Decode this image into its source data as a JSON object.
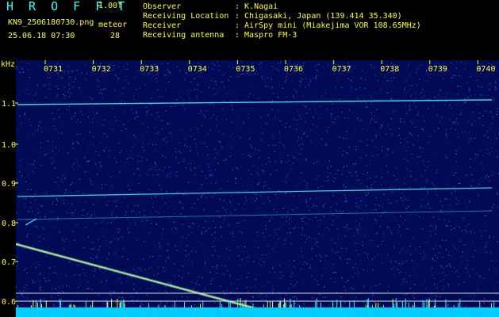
{
  "header": {
    "logo": "H R O F F T",
    "version": "1.00f",
    "filename": "KN9_2506180730.png",
    "meteor_label": "meteor",
    "datetime": "25.06.18 07:30",
    "meteor_count": "28",
    "info": [
      {
        "label": "Observer",
        "value": ": K.Nagai"
      },
      {
        "label": "Receiving Location",
        "value": ": Chigasaki, Japan (139.414 35.340)"
      },
      {
        "label": "Receiver",
        "value": ": AirSpy mini (Miakejima VOR 108.65MHz)"
      },
      {
        "label": "Receiving antenna",
        "value": ": Maspro FM-3"
      }
    ]
  },
  "spectrogram": {
    "y_unit": "kHz",
    "y_ticks": [
      "1.1",
      "1.0",
      "0.9",
      "0.8",
      "0.7",
      "0.6"
    ],
    "time_labels": [
      "0731",
      "0732",
      "0733",
      "0734",
      "0735",
      "0736",
      "0737",
      "0738",
      "0739",
      "0740"
    ],
    "colors": {
      "background": "#000a55",
      "noise": "#3355dd",
      "trace": "#44eeee",
      "baseline": "#00ccff",
      "label": "#ffff33"
    }
  }
}
